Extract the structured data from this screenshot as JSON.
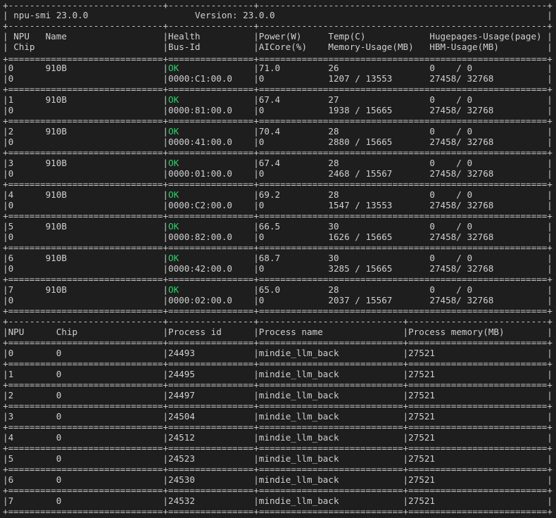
{
  "header": {
    "tool": "npu-smi 23.0.0",
    "version_label": "Version: 23.0.0"
  },
  "npu_table": {
    "header_row1": [
      "NPU",
      "Name",
      "Health",
      "Power(W)",
      "Temp(C)",
      "Hugepages-Usage(page)"
    ],
    "header_row2": [
      "Chip",
      "",
      "Bus-Id",
      "AICore(%)",
      "Memory-Usage(MB)",
      "HBM-Usage(MB)"
    ],
    "rows": [
      {
        "npu": "0",
        "name": "910B",
        "health": "OK",
        "power": "71.0",
        "temp": "26",
        "hugepages": "0    / 0",
        "chip": "0",
        "bus_id": "0000:C1:00.0",
        "aicore": "0",
        "memory": "1207 / 13553",
        "hbm": "27458/ 32768"
      },
      {
        "npu": "1",
        "name": "910B",
        "health": "OK",
        "power": "67.4",
        "temp": "27",
        "hugepages": "0    / 0",
        "chip": "0",
        "bus_id": "0000:81:00.0",
        "aicore": "0",
        "memory": "1938 / 15665",
        "hbm": "27458/ 32768"
      },
      {
        "npu": "2",
        "name": "910B",
        "health": "OK",
        "power": "70.4",
        "temp": "28",
        "hugepages": "0    / 0",
        "chip": "0",
        "bus_id": "0000:41:00.0",
        "aicore": "0",
        "memory": "2880 / 15665",
        "hbm": "27458/ 32768"
      },
      {
        "npu": "3",
        "name": "910B",
        "health": "OK",
        "power": "67.4",
        "temp": "28",
        "hugepages": "0    / 0",
        "chip": "0",
        "bus_id": "0000:01:00.0",
        "aicore": "0",
        "memory": "2468 / 15567",
        "hbm": "27458/ 32768"
      },
      {
        "npu": "4",
        "name": "910B",
        "health": "OK",
        "power": "69.2",
        "temp": "28",
        "hugepages": "0    / 0",
        "chip": "0",
        "bus_id": "0000:C2:00.0",
        "aicore": "0",
        "memory": "1547 / 13553",
        "hbm": "27458/ 32768"
      },
      {
        "npu": "5",
        "name": "910B",
        "health": "OK",
        "power": "66.5",
        "temp": "30",
        "hugepages": "0    / 0",
        "chip": "0",
        "bus_id": "0000:82:00.0",
        "aicore": "0",
        "memory": "1626 / 15665",
        "hbm": "27458/ 32768"
      },
      {
        "npu": "6",
        "name": "910B",
        "health": "OK",
        "power": "68.7",
        "temp": "30",
        "hugepages": "0    / 0",
        "chip": "0",
        "bus_id": "0000:42:00.0",
        "aicore": "0",
        "memory": "3285 / 15665",
        "hbm": "27458/ 32768"
      },
      {
        "npu": "7",
        "name": "910B",
        "health": "OK",
        "power": "65.0",
        "temp": "28",
        "hugepages": "0    / 0",
        "chip": "0",
        "bus_id": "0000:02:00.0",
        "aicore": "0",
        "memory": "2037 / 15567",
        "hbm": "27458/ 32768"
      }
    ]
  },
  "process_table": {
    "headers": [
      "NPU",
      "Chip",
      "Process id",
      "Process name",
      "Process memory(MB)"
    ],
    "rows": [
      {
        "npu": "0",
        "chip": "0",
        "pid": "24493",
        "name": "mindie_llm_back",
        "memory": "27521"
      },
      {
        "npu": "1",
        "chip": "0",
        "pid": "24495",
        "name": "mindie_llm_back",
        "memory": "27521"
      },
      {
        "npu": "2",
        "chip": "0",
        "pid": "24497",
        "name": "mindie_llm_back",
        "memory": "27521"
      },
      {
        "npu": "3",
        "chip": "0",
        "pid": "24504",
        "name": "mindie_llm_back",
        "memory": "27521"
      },
      {
        "npu": "4",
        "chip": "0",
        "pid": "24512",
        "name": "mindie_llm_back",
        "memory": "27521"
      },
      {
        "npu": "5",
        "chip": "0",
        "pid": "24523",
        "name": "mindie_llm_back",
        "memory": "27521"
      },
      {
        "npu": "6",
        "chip": "0",
        "pid": "24530",
        "name": "mindie_llm_back",
        "memory": "27521"
      },
      {
        "npu": "7",
        "chip": "0",
        "pid": "24532",
        "name": "mindie_llm_back",
        "memory": "27521"
      }
    ]
  },
  "colors": {
    "background": "#1e1e1e",
    "text": "#d0d0d0",
    "health_ok": "#2bd46b"
  }
}
